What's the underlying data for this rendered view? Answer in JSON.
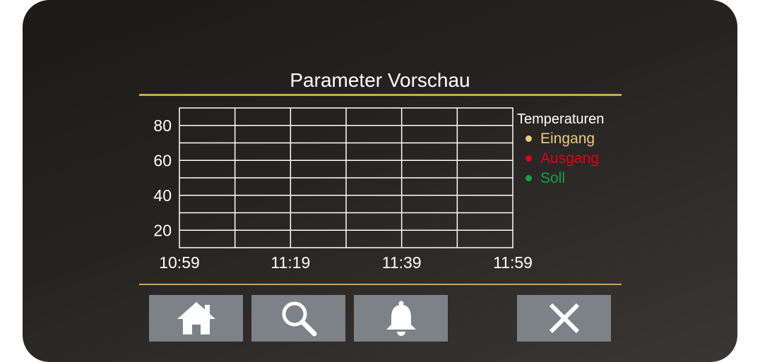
{
  "screen": {
    "title": "Parameter Vorschau"
  },
  "colors": {
    "background": "#252321",
    "gold": "#c9a94f",
    "grid": "#ffffff",
    "button": "#7c8286",
    "icon": "#ffffff"
  },
  "chart_data": {
    "type": "line",
    "title": "",
    "xlabel": "",
    "ylabel": "",
    "x_ticks": [
      "10:59",
      "11:19",
      "11:39",
      "11:59"
    ],
    "y_ticks": [
      20,
      40,
      60,
      80
    ],
    "ylim": [
      10,
      90
    ],
    "grid": true,
    "legend_title": "Temperaturen",
    "legend_position": "right",
    "series": [
      {
        "name": "Eingang",
        "color": "#e8cc7e",
        "values": []
      },
      {
        "name": "Ausgang",
        "color": "#e2001a",
        "values": []
      },
      {
        "name": "Soll",
        "color": "#13a149",
        "values": []
      }
    ]
  },
  "buttons": [
    {
      "icon": "home-icon"
    },
    {
      "icon": "search-icon"
    },
    {
      "icon": "bell-icon"
    },
    {
      "icon": "close-icon"
    }
  ]
}
